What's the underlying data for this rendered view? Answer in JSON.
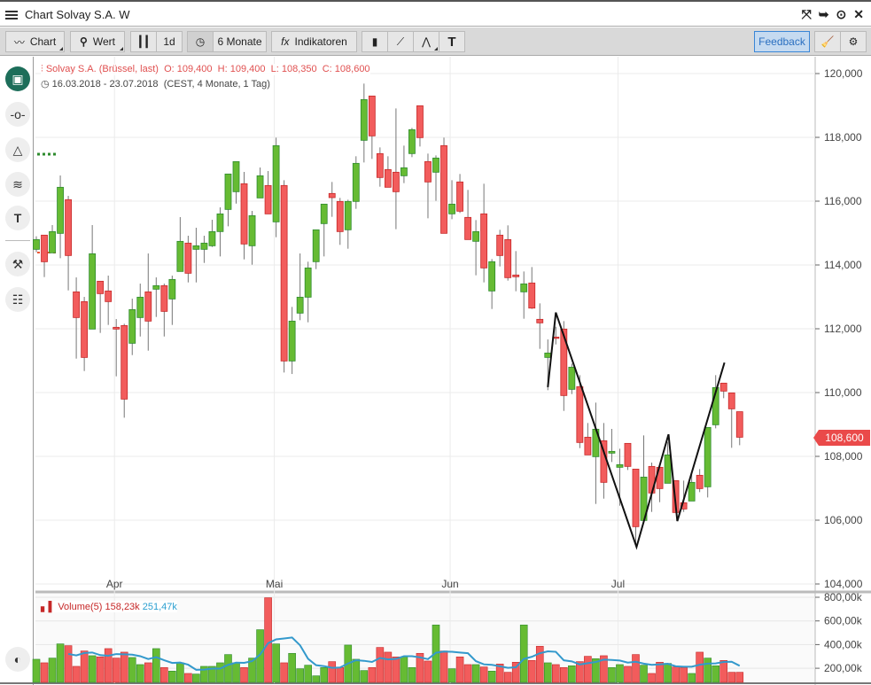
{
  "window": {
    "title": "Chart Solvay S.A. W",
    "icons": [
      "fullscreen-icon",
      "popout-icon",
      "target-icon",
      "close-icon"
    ]
  },
  "toolbar": {
    "chart": "Chart",
    "wert": "Wert",
    "interval": "1d",
    "period": "6 Monate",
    "fx": "fx",
    "indicators": "Indikatoren",
    "feedback": "Feedback"
  },
  "legend": {
    "instrument": "Solvay S.A. (Brüssel, last)",
    "open": "O: 109,400",
    "high": "H: 109,400",
    "low": "L: 108,350",
    "close": "C: 108,600",
    "range": "16.03.2018 - 23.07.2018",
    "range_info": "(CEST, 4 Monate, 1 Tag)"
  },
  "volume_legend": {
    "label": "Volume(5)",
    "value": "158,23k",
    "ma": "251,47k"
  },
  "last_price": "108,600",
  "colors": {
    "up": "#66bb33",
    "down": "#f25c5c",
    "volume_ma": "#3399cc",
    "last_badge": "#ea4a4a",
    "active_tool": "#1d6e5a"
  },
  "chart_data": {
    "type": "candlestick",
    "y_ticks": [
      "120,000",
      "118,000",
      "116,000",
      "114,000",
      "112,000",
      "110,000",
      "108,000",
      "106,000",
      "104,000"
    ],
    "ylim": [
      104000,
      120000
    ],
    "x_ticks": [
      {
        "label": "Apr",
        "index": 10
      },
      {
        "label": "Mai",
        "index": 30
      },
      {
        "label": "Jun",
        "index": 52
      },
      {
        "label": "Jul",
        "index": 73
      }
    ],
    "ohlc": [
      [
        114490,
        114900,
        114400,
        114796
      ],
      [
        114935,
        114935,
        113620,
        114101
      ],
      [
        114379,
        115250,
        114379,
        115046
      ],
      [
        114990,
        116805,
        114212,
        116435
      ],
      [
        116046,
        116166,
        113203,
        114296
      ],
      [
        113157,
        113610,
        111064,
        112351
      ],
      [
        112851,
        112999,
        110675,
        111101
      ],
      [
        111990,
        115250,
        111990,
        114351
      ],
      [
        113490,
        113490,
        111870,
        113101
      ],
      [
        113185,
        113666,
        112120,
        112851
      ],
      [
        112046,
        112305,
        110509,
        111990
      ],
      [
        112101,
        112157,
        109212,
        109795
      ],
      [
        111545,
        112944,
        111175,
        112601
      ],
      [
        112351,
        113416,
        111758,
        112990
      ],
      [
        113157,
        114360,
        111314,
        112240
      ],
      [
        113240,
        113610,
        112370,
        113351
      ],
      [
        113351,
        113416,
        111758,
        112545
      ],
      [
        112934,
        113666,
        112120,
        113546
      ],
      [
        113796,
        115500,
        113796,
        114740
      ],
      [
        114685,
        114916,
        113453,
        113740
      ],
      [
        114490,
        115166,
        113453,
        114601
      ],
      [
        114490,
        114916,
        114064,
        114685
      ],
      [
        114601,
        115416,
        114564,
        115046
      ],
      [
        115046,
        115805,
        114268,
        115601
      ],
      [
        115740,
        116851,
        115212,
        116851
      ],
      [
        116296,
        117240,
        115925,
        117240
      ],
      [
        116546,
        116916,
        114175,
        114657
      ],
      [
        114601,
        115694,
        114009,
        115546
      ],
      [
        116101,
        117055,
        116101,
        116796
      ],
      [
        116490,
        116944,
        115601,
        115601
      ],
      [
        115351,
        117990,
        114870,
        117740
      ],
      [
        116491,
        116657,
        110629,
        110990
      ],
      [
        110990,
        112685,
        110582,
        112240
      ],
      [
        112490,
        114361,
        112268,
        112990
      ],
      [
        112990,
        114102,
        112203,
        113907
      ],
      [
        114102,
        115102,
        113870,
        115102
      ],
      [
        115296,
        115907,
        114268,
        115907
      ],
      [
        116241,
        116602,
        115509,
        116111
      ],
      [
        115991,
        116102,
        114630,
        115046
      ],
      [
        115102,
        116046,
        114509,
        115991
      ],
      [
        115991,
        117407,
        115759,
        117185
      ],
      [
        117907,
        119685,
        117213,
        119185
      ],
      [
        119296,
        119296,
        117324,
        118046
      ],
      [
        117491,
        117685,
        116454,
        116741
      ],
      [
        116991,
        117407,
        116435,
        116435
      ],
      [
        116907,
        118907,
        115120,
        116296
      ],
      [
        116796,
        117741,
        116565,
        117046
      ],
      [
        117491,
        118296,
        117380,
        118241
      ],
      [
        118991,
        118991,
        117713,
        117991
      ],
      [
        117241,
        117491,
        115463,
        116602
      ],
      [
        116907,
        117435,
        116009,
        117352
      ],
      [
        117741,
        117991,
        114991,
        114991
      ],
      [
        115602,
        116657,
        115435,
        115907
      ],
      [
        116602,
        116852,
        115630,
        115685
      ],
      [
        115491,
        116352,
        114796,
        114796
      ],
      [
        114741,
        115407,
        113676,
        115046
      ],
      [
        115602,
        116546,
        113454,
        113907
      ],
      [
        113185,
        114185,
        112620,
        114102
      ],
      [
        114935,
        115102,
        113954,
        114296
      ],
      [
        114796,
        115241,
        113509,
        113602
      ],
      [
        113685,
        114435,
        113176,
        113630
      ],
      [
        113157,
        113796,
        112315,
        113407
      ],
      [
        113435,
        113935,
        112620,
        112648
      ],
      [
        112296,
        112796,
        111370,
        112185
      ],
      [
        111101,
        111666,
        110074,
        111240
      ],
      [
        111740,
        112064,
        111509,
        111712
      ],
      [
        111990,
        112240,
        109425,
        109907
      ],
      [
        110101,
        110907,
        109953,
        110796
      ],
      [
        110185,
        110546,
        108259,
        108435
      ],
      [
        108601,
        109046,
        108046,
        108046
      ],
      [
        107990,
        109685,
        106509,
        108851
      ],
      [
        108490,
        109046,
        106675,
        107185
      ],
      [
        108101,
        108861,
        107823,
        108157
      ],
      [
        107657,
        108240,
        106453,
        107740
      ],
      [
        108407,
        108407,
        107573,
        107685
      ],
      [
        107601,
        107601,
        105212,
        105796
      ],
      [
        105990,
        108657,
        105990,
        107351
      ],
      [
        107685,
        107805,
        106259,
        106851
      ],
      [
        107657,
        107657,
        106564,
        106990
      ],
      [
        107157,
        108453,
        107157,
        108046
      ],
      [
        107240,
        107240,
        106240,
        106240
      ],
      [
        106546,
        107240,
        106259,
        106351
      ],
      [
        106601,
        107435,
        106601,
        107185
      ],
      [
        107407,
        107601,
        106879,
        106990
      ],
      [
        107046,
        108907,
        106712,
        108907
      ],
      [
        108990,
        110546,
        108879,
        110157
      ],
      [
        110296,
        110296,
        109823,
        110046
      ],
      [
        109990,
        109990,
        108268,
        109490
      ],
      [
        109400,
        109400,
        108350,
        108600
      ]
    ],
    "volume_k": [
      270,
      240,
      280,
      400,
      385,
      210,
      340,
      300,
      290,
      360,
      280,
      330,
      285,
      225,
      240,
      360,
      200,
      170,
      240,
      150,
      145,
      210,
      210,
      240,
      310,
      240,
      200,
      280,
      520,
      790,
      400,
      240,
      320,
      190,
      220,
      130,
      200,
      250,
      200,
      390,
      270,
      175,
      200,
      370,
      330,
      290,
      290,
      200,
      320,
      255,
      560,
      340,
      190,
      290,
      225,
      225,
      205,
      170,
      230,
      160,
      245,
      560,
      260,
      380,
      240,
      225,
      200,
      215,
      250,
      295,
      275,
      300,
      200,
      225,
      210,
      310,
      220,
      150,
      245,
      235,
      205,
      200,
      150,
      330,
      280,
      215,
      260,
      160,
      160
    ],
    "volume_ticks": [
      "800,00k",
      "600,00k",
      "400,00k",
      "200,00k"
    ],
    "volume_ma_period": 5,
    "drawing": [
      [
        64,
        110170
      ],
      [
        65,
        112510
      ],
      [
        75.1,
        105160
      ],
      [
        79.1,
        108690
      ],
      [
        80.2,
        105970
      ],
      [
        86.1,
        110940
      ]
    ]
  }
}
